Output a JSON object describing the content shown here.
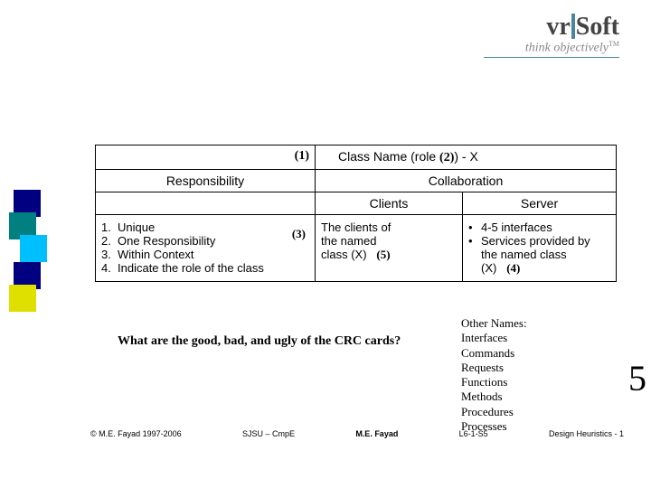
{
  "logo": {
    "brand_left": "vr",
    "brand_right": "Soft",
    "tagline": "think objectively",
    "tm": "TM"
  },
  "table": {
    "marker1": "(1)",
    "class_name": "Class Name (role",
    "marker2": "(2)",
    "class_tail": ") - X",
    "responsibility_hdr": "Responsibility",
    "collaboration_hdr": "Collaboration",
    "clients_hdr": "Clients",
    "server_hdr": "Server",
    "resp": {
      "n1": "1.",
      "t1": "Unique",
      "n2": "2.",
      "t2": "One Responsibility",
      "n3": "3.",
      "t3": "Within Context",
      "n4": "4.",
      "t4": "Indicate the role of the class",
      "marker3": "(3)"
    },
    "clients": {
      "line1": "The clients of",
      "line2": "the named",
      "line3a": "class (X)",
      "marker5": "(5)"
    },
    "server": {
      "b1": "•",
      "t1": "4-5 interfaces",
      "b2": "•",
      "t2": "Services provided by the named class (X)",
      "marker4": "(4)"
    }
  },
  "question": "What are the good, bad, and ugly of the CRC cards?",
  "other_names": {
    "head": "Other Names:",
    "l1": "Interfaces",
    "l2": "Commands",
    "l3": "Requests",
    "l4": "Functions",
    "l5": "Methods",
    "l6": "Procedures",
    "l7": "Processes"
  },
  "big5": "5",
  "footer": {
    "copyright": "© M.E. Fayad 1997-2006",
    "center": "SJSU – CmpE",
    "author": "M.E. Fayad",
    "code": "L6-1-S5",
    "right": "Design Heuristics -  1"
  }
}
